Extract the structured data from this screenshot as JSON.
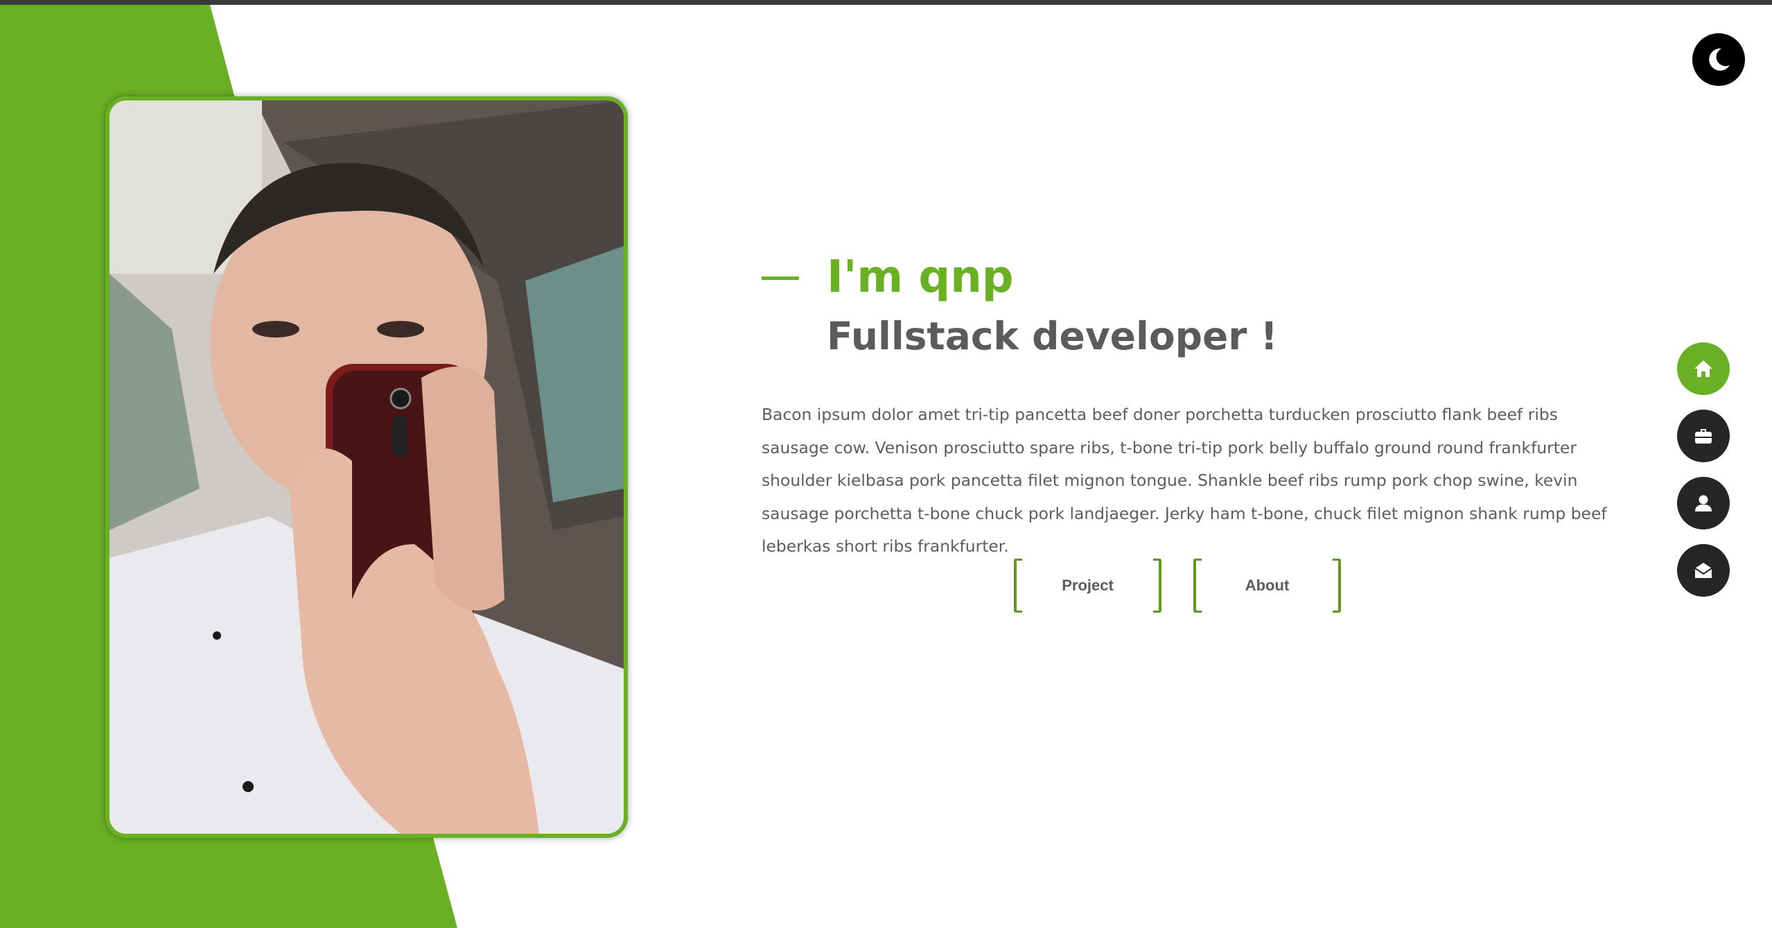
{
  "theme": {
    "accent": "#6ab023",
    "dark": "#262626",
    "text": "#5b5b5b"
  },
  "theme_toggle": {
    "icon": "moon-icon"
  },
  "hero": {
    "greeting": "I'm qnp",
    "role": "Fullstack developer !",
    "description": "Bacon ipsum dolor amet tri-tip pancetta beef doner porchetta turducken prosciutto flank beef ribs sausage cow. Venison prosciutto spare ribs, t-bone tri-tip pork belly buffalo ground round frankfurter shoulder kielbasa pork pancetta filet mignon tongue. Shankle beef ribs rump pork chop swine, kevin sausage porchetta t-bone chuck pork landjaeger. Jerky ham t-bone, chuck filet mignon shank rump beef leberkas short ribs frankfurter."
  },
  "buttons": {
    "project_label": "Project",
    "about_label": "About"
  },
  "side_nav": {
    "items": [
      {
        "icon": "home-icon",
        "active": true
      },
      {
        "icon": "briefcase-icon",
        "active": false
      },
      {
        "icon": "user-icon",
        "active": false
      },
      {
        "icon": "envelope-open-icon",
        "active": false
      }
    ]
  }
}
